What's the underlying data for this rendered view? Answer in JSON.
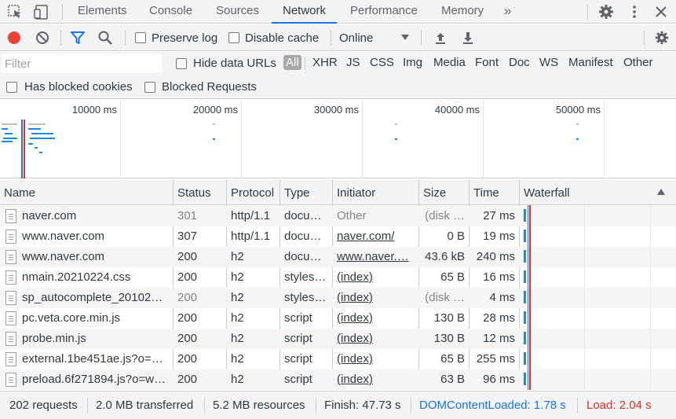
{
  "tabs": [
    {
      "label": "Elements"
    },
    {
      "label": "Console"
    },
    {
      "label": "Sources"
    },
    {
      "label": "Network",
      "active": true
    },
    {
      "label": "Performance"
    },
    {
      "label": "Memory"
    }
  ],
  "tabs_more": "»",
  "toolbar": {
    "preserve_log": "Preserve log",
    "disable_cache": "Disable cache",
    "throttling": "Online"
  },
  "filter": {
    "placeholder": "Filter",
    "hide_data_urls": "Hide data URLs",
    "types": [
      "All",
      "XHR",
      "JS",
      "CSS",
      "Img",
      "Media",
      "Font",
      "Doc",
      "WS",
      "Manifest",
      "Other"
    ],
    "has_blocked_cookies": "Has blocked cookies",
    "blocked_requests": "Blocked Requests"
  },
  "overview": {
    "ticks": [
      "10000 ms",
      "20000 ms",
      "30000 ms",
      "40000 ms",
      "50000 ms"
    ]
  },
  "columns": [
    "Name",
    "Status",
    "Protocol",
    "Type",
    "Initiator",
    "Size",
    "Time",
    "Waterfall"
  ],
  "rows": [
    {
      "name": "naver.com",
      "status": "301",
      "protocol": "http/1.1",
      "type": "docu…",
      "initiator": "Other",
      "size": "(disk …",
      "time": "27 ms"
    },
    {
      "name": "www.naver.com",
      "status": "307",
      "protocol": "http/1.1",
      "type": "docu…",
      "initiator": "naver.com/",
      "size": "0 B",
      "time": "19 ms"
    },
    {
      "name": "www.naver.com",
      "status": "200",
      "protocol": "h2",
      "type": "docu…",
      "initiator": "www.naver.…",
      "size": "43.6 kB",
      "time": "240 ms"
    },
    {
      "name": "nmain.20210224.css",
      "status": "200",
      "protocol": "h2",
      "type": "styles…",
      "initiator": "(index)",
      "size": "65 B",
      "time": "16 ms"
    },
    {
      "name": "sp_autocomplete_20102…",
      "status": "200",
      "protocol": "h2",
      "type": "styles…",
      "initiator": "(index)",
      "size": "(disk …",
      "time": "4 ms"
    },
    {
      "name": "pc.veta.core.min.js",
      "status": "200",
      "protocol": "h2",
      "type": "script",
      "initiator": "(index)",
      "size": "130 B",
      "time": "28 ms"
    },
    {
      "name": "probe.min.js",
      "status": "200",
      "protocol": "h2",
      "type": "script",
      "initiator": "(index)",
      "size": "130 B",
      "time": "12 ms"
    },
    {
      "name": "external.1be451ae.js?o=…",
      "status": "200",
      "protocol": "h2",
      "type": "script",
      "initiator": "(index)",
      "size": "65 B",
      "time": "255 ms"
    },
    {
      "name": "preload.6f271894.js?o=w…",
      "status": "200",
      "protocol": "h2",
      "type": "script",
      "initiator": "(index)",
      "size": "63 B",
      "time": "96 ms"
    }
  ],
  "status_bar": {
    "requests": "202 requests",
    "transferred": "2.0 MB transferred",
    "resources": "5.2 MB resources",
    "finish": "Finish: 47.73 s",
    "dom_content_loaded": "DOMContentLoaded: 1.78 s",
    "load": "Load: 2.04 s"
  },
  "colors": {
    "accent": "#1a73e8",
    "record": "#ea4335",
    "dcl": "#1a73e8",
    "load": "#d93025",
    "bar": "#1e88e5"
  }
}
